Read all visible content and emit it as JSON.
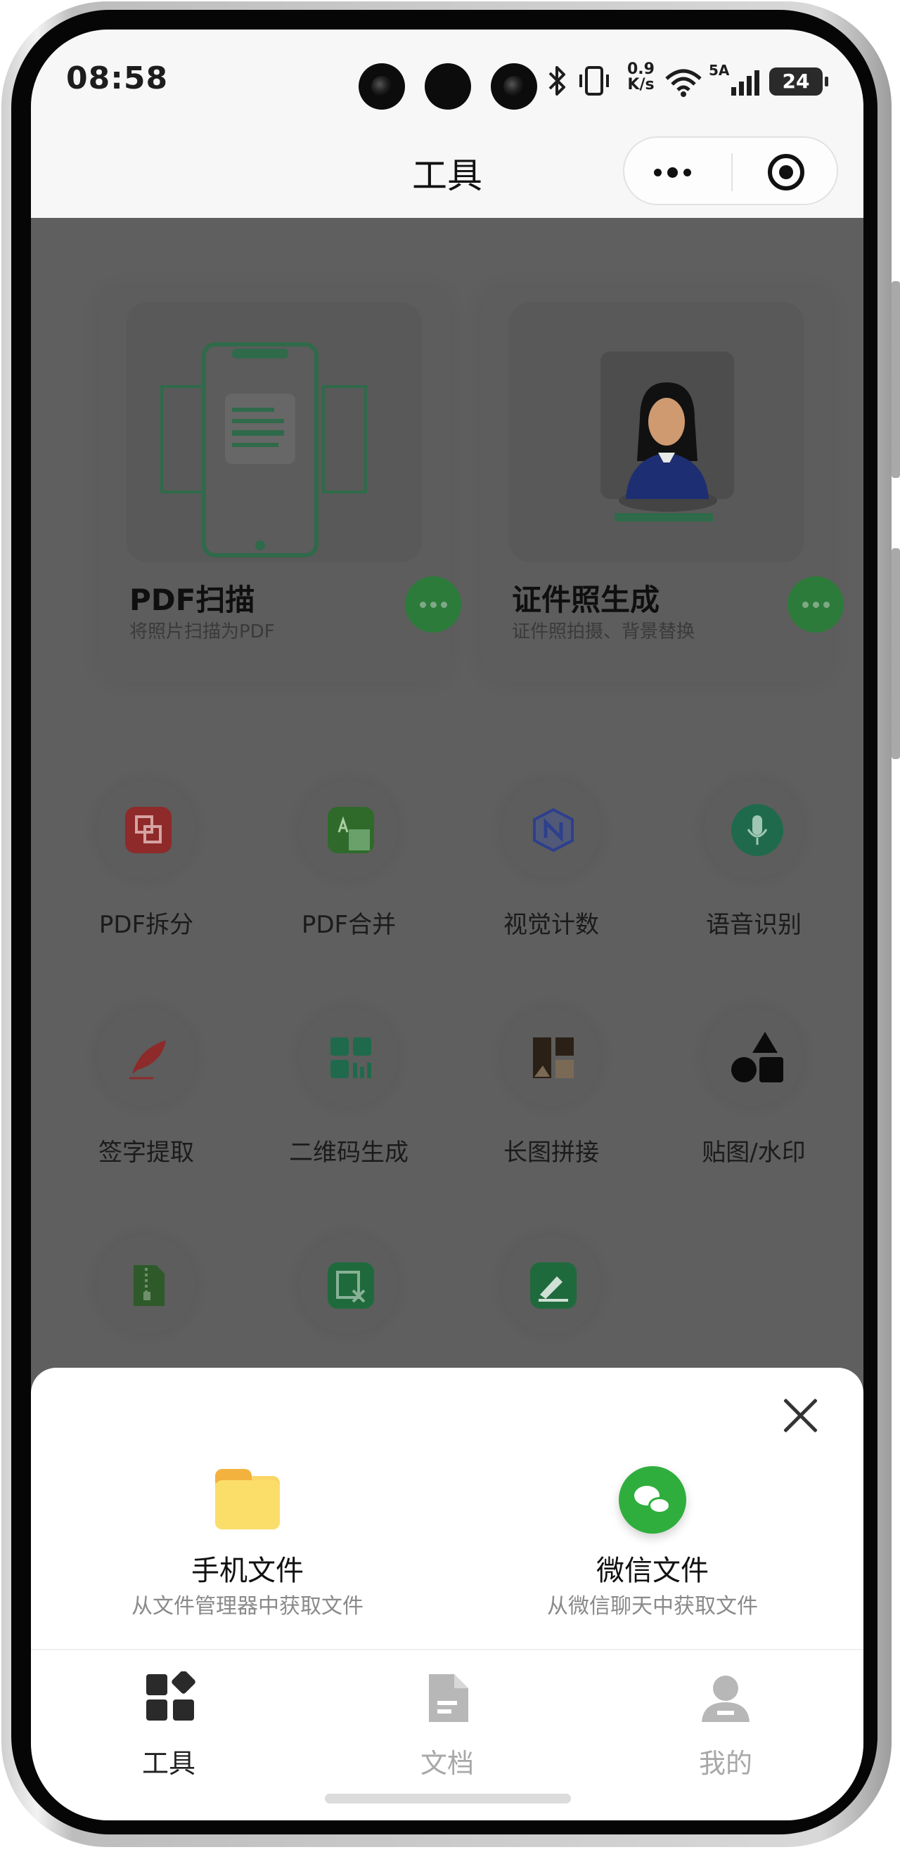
{
  "status_bar": {
    "time": "08:58",
    "net_speed_value": "0.9",
    "net_speed_unit": "K/s",
    "signal_label": "5A",
    "battery": "24"
  },
  "nav": {
    "title": "工具"
  },
  "featured_tools": [
    {
      "title": "PDF扫描",
      "subtitle": "将照片扫描为PDF",
      "icon": "phone-scan-icon"
    },
    {
      "title": "证件照生成",
      "subtitle": "证件照拍摄、背景替换",
      "icon": "id-photo-icon"
    }
  ],
  "tools": [
    {
      "label": "PDF拆分",
      "icon": "pdf-split-icon",
      "color": "#8e2a2a"
    },
    {
      "label": "PDF合并",
      "icon": "pdf-merge-icon",
      "color": "#2f6a2a"
    },
    {
      "label": "视觉计数",
      "icon": "vision-count-icon",
      "color": "#2e3f8c"
    },
    {
      "label": "语音识别",
      "icon": "microphone-icon",
      "color": "#1f6a4c"
    },
    {
      "label": "签字提取",
      "icon": "feather-pen-icon",
      "color": "#8e2a2a"
    },
    {
      "label": "二维码生成",
      "icon": "qr-grid-icon",
      "color": "#1f6a4c"
    },
    {
      "label": "长图拼接",
      "icon": "image-stitch-icon",
      "color": "#4a3a26"
    },
    {
      "label": "贴图/水印",
      "icon": "shapes-icon",
      "color": "#111111"
    },
    {
      "label": "",
      "icon": "zip-file-icon",
      "color": "#2e5a2a"
    },
    {
      "label": "",
      "icon": "file-edit-icon",
      "color": "#1f6a3c"
    },
    {
      "label": "",
      "icon": "sign-pad-icon",
      "color": "#1f6a3c"
    }
  ],
  "sheet": {
    "sources": [
      {
        "title": "手机文件",
        "subtitle": "从文件管理器中获取文件",
        "icon": "folder-icon"
      },
      {
        "title": "微信文件",
        "subtitle": "从微信聊天中获取文件",
        "icon": "wechat-icon"
      }
    ]
  },
  "tabs": [
    {
      "label": "工具",
      "icon": "tools-grid-icon",
      "active": true
    },
    {
      "label": "文档",
      "icon": "document-icon",
      "active": false
    },
    {
      "label": "我的",
      "icon": "profile-icon",
      "active": false
    }
  ],
  "colors": {
    "accent_green": "#2fae3d",
    "overlay_dim": "#606060",
    "active_tab": "#222222",
    "inactive_tab": "#b5b5b5"
  }
}
